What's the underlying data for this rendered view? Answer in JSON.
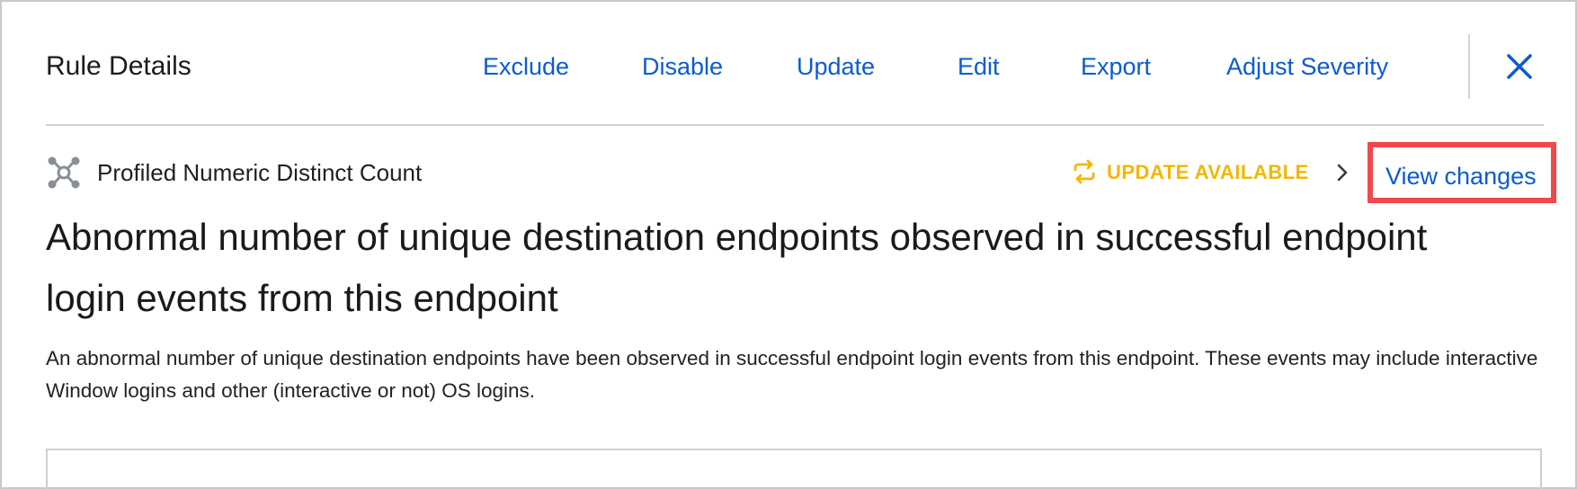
{
  "header": {
    "title": "Rule Details",
    "actions": {
      "exclude": "Exclude",
      "disable": "Disable",
      "update": "Update",
      "edit": "Edit",
      "export": "Export",
      "adjust_severity": "Adjust Severity"
    },
    "close_icon": "close-icon"
  },
  "rule": {
    "type_icon": "network-nodes-icon",
    "type_label": "Profiled Numeric Distinct Count",
    "update_status": "UPDATE AVAILABLE",
    "update_icon": "refresh-icon",
    "view_changes_label": "View changes",
    "title": "Abnormal number of unique destination endpoints observed in successful endpoint login events from this endpoint",
    "description": "An abnormal number of unique destination endpoints have been observed in successful endpoint login events from this endpoint. These events may include interactive Window logins and other (interactive or not) OS logins."
  },
  "colors": {
    "link": "#0b5bd3",
    "update_status": "#f2b705",
    "highlight_border": "#f0484b",
    "divider": "#cfcfcf"
  }
}
